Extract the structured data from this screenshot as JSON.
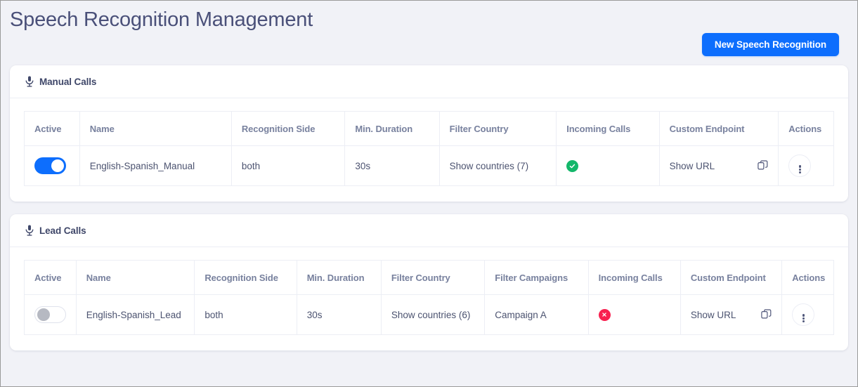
{
  "page": {
    "title": "Speech Recognition Management",
    "background_color": "#f1f2f7",
    "title_color": "#4a5079"
  },
  "actions": {
    "new_button_label": "New Speech Recognition",
    "new_button_color": "#0d6efd"
  },
  "sections": [
    {
      "id": "manual-calls",
      "icon": "microphone-icon",
      "title": "Manual Calls",
      "columns": [
        "Active",
        "Name",
        "Recognition Side",
        "Min. Duration",
        "Filter Country",
        "Incoming Calls",
        "Custom Endpoint",
        "Actions"
      ],
      "rows": [
        {
          "active": true,
          "name": "English-Spanish_Manual",
          "recognition_side": "both",
          "min_duration": "30s",
          "filter_country": "Show countries (7)",
          "incoming_calls": "enabled",
          "custom_endpoint": "Show URL",
          "copy_icon": "copy-icon",
          "actions_icon": "kebab-menu-icon"
        }
      ]
    },
    {
      "id": "lead-calls",
      "icon": "microphone-icon",
      "title": "Lead Calls",
      "columns": [
        "Active",
        "Name",
        "Recognition Side",
        "Min. Duration",
        "Filter Country",
        "Filter Campaigns",
        "Incoming Calls",
        "Custom Endpoint",
        "Actions"
      ],
      "rows": [
        {
          "active": false,
          "name": "English-Spanish_Lead",
          "recognition_side": "both",
          "min_duration": "30s",
          "filter_country": "Show countries (6)",
          "filter_campaigns": "Campaign A",
          "incoming_calls": "disabled",
          "custom_endpoint": "Show URL",
          "copy_icon": "copy-icon",
          "actions_icon": "kebab-menu-icon"
        }
      ]
    }
  ],
  "status_colors": {
    "enabled": "#13b76a",
    "disabled": "#f8204f"
  }
}
